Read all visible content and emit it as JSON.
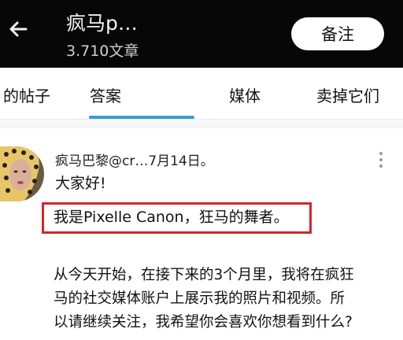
{
  "header": {
    "title": "疯马p…",
    "subtitle": "3.710文章",
    "note_label": "备注",
    "back_icon": "arrow-left-icon"
  },
  "tabs": [
    {
      "label": "的帖子",
      "active": false
    },
    {
      "label": "答案",
      "active": true
    },
    {
      "label": "媒体",
      "active": false
    },
    {
      "label": "卖掉它们",
      "active": false
    }
  ],
  "colors": {
    "header_bg": "#070707",
    "tab_indicator": "#3d9ad6",
    "highlight_border": "#d3262b"
  },
  "post": {
    "meta": "疯马巴黎@cr…7月14日。",
    "line1": "大家好!",
    "line2": "我是Pixelle Canon，狂马的舞者。",
    "paragraph": [
      "从今天开始，在接下来的3个月里，我将在疯狂",
      "马的社交媒体账户上展示我的照片和视频。所",
      "以请继续关注，我希望你会喜欢你想看到什么?"
    ],
    "more_icon": "more-vertical-icon",
    "avatar_icon": "avatar"
  }
}
